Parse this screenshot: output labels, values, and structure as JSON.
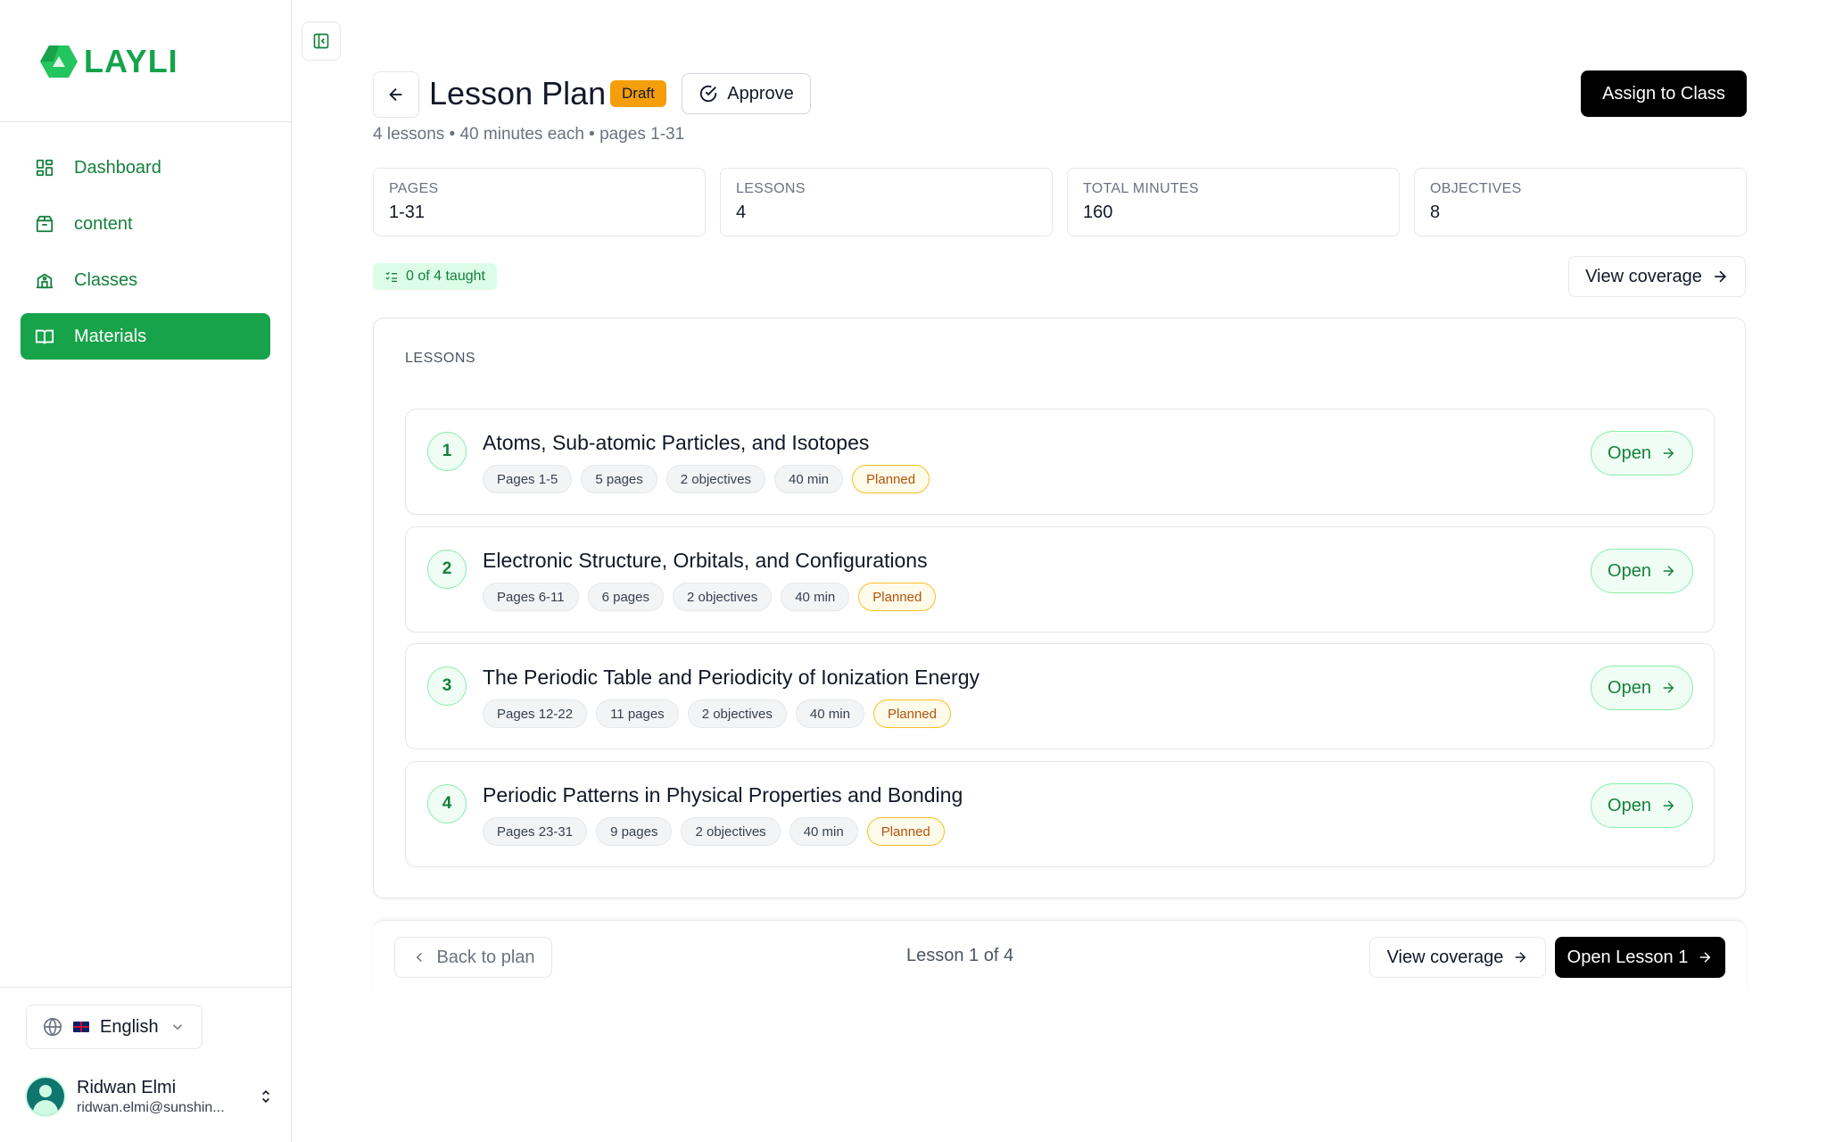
{
  "app": {
    "name": "LAYLI",
    "brand_color": "#16a34a"
  },
  "sidebar": {
    "items": [
      {
        "label": "Dashboard",
        "icon": "dashboard-icon",
        "active": false
      },
      {
        "label": "content",
        "icon": "package-icon",
        "active": false
      },
      {
        "label": "Classes",
        "icon": "school-icon",
        "active": false
      },
      {
        "label": "Materials",
        "icon": "book-open-icon",
        "active": true
      }
    ],
    "language": "English",
    "user": {
      "name": "Ridwan Elmi",
      "email": "ridwan.elmi@sunshin..."
    }
  },
  "header": {
    "title": "Lesson Plan",
    "status": "Draft",
    "approve_label": "Approve",
    "assign_label": "Assign to Class",
    "subtitle": "4 lessons • 40 minutes each • pages 1-31"
  },
  "stats": [
    {
      "label": "PAGES",
      "value": "1-31"
    },
    {
      "label": "LESSONS",
      "value": "4"
    },
    {
      "label": "TOTAL MINUTES",
      "value": "160"
    },
    {
      "label": "OBJECTIVES",
      "value": "8"
    }
  ],
  "progress": {
    "label": "0 of 4 taught"
  },
  "coverage_label": "View coverage",
  "lessons_section": {
    "label": "LESSONS",
    "open_label": "Open",
    "items": [
      {
        "num": "1",
        "title": "Atoms, Sub-atomic Particles, and Isotopes",
        "pages": "Pages 1-5",
        "page_count": "5 pages",
        "objectives": "2 objectives",
        "duration": "40 min",
        "status": "Planned"
      },
      {
        "num": "2",
        "title": "Electronic Structure, Orbitals, and Configurations",
        "pages": "Pages 6-11",
        "page_count": "6 pages",
        "objectives": "2 objectives",
        "duration": "40 min",
        "status": "Planned"
      },
      {
        "num": "3",
        "title": "The Periodic Table and Periodicity of Ionization Energy",
        "pages": "Pages 12-22",
        "page_count": "11 pages",
        "objectives": "2 objectives",
        "duration": "40 min",
        "status": "Planned"
      },
      {
        "num": "4",
        "title": "Periodic Patterns in Physical Properties and Bonding",
        "pages": "Pages 23-31",
        "page_count": "9 pages",
        "objectives": "2 objectives",
        "duration": "40 min",
        "status": "Planned"
      }
    ]
  },
  "footer": {
    "back_label": "Back to plan",
    "position": "Lesson 1 of 4",
    "coverage_label": "View coverage",
    "open_lesson_label": "Open Lesson 1"
  }
}
